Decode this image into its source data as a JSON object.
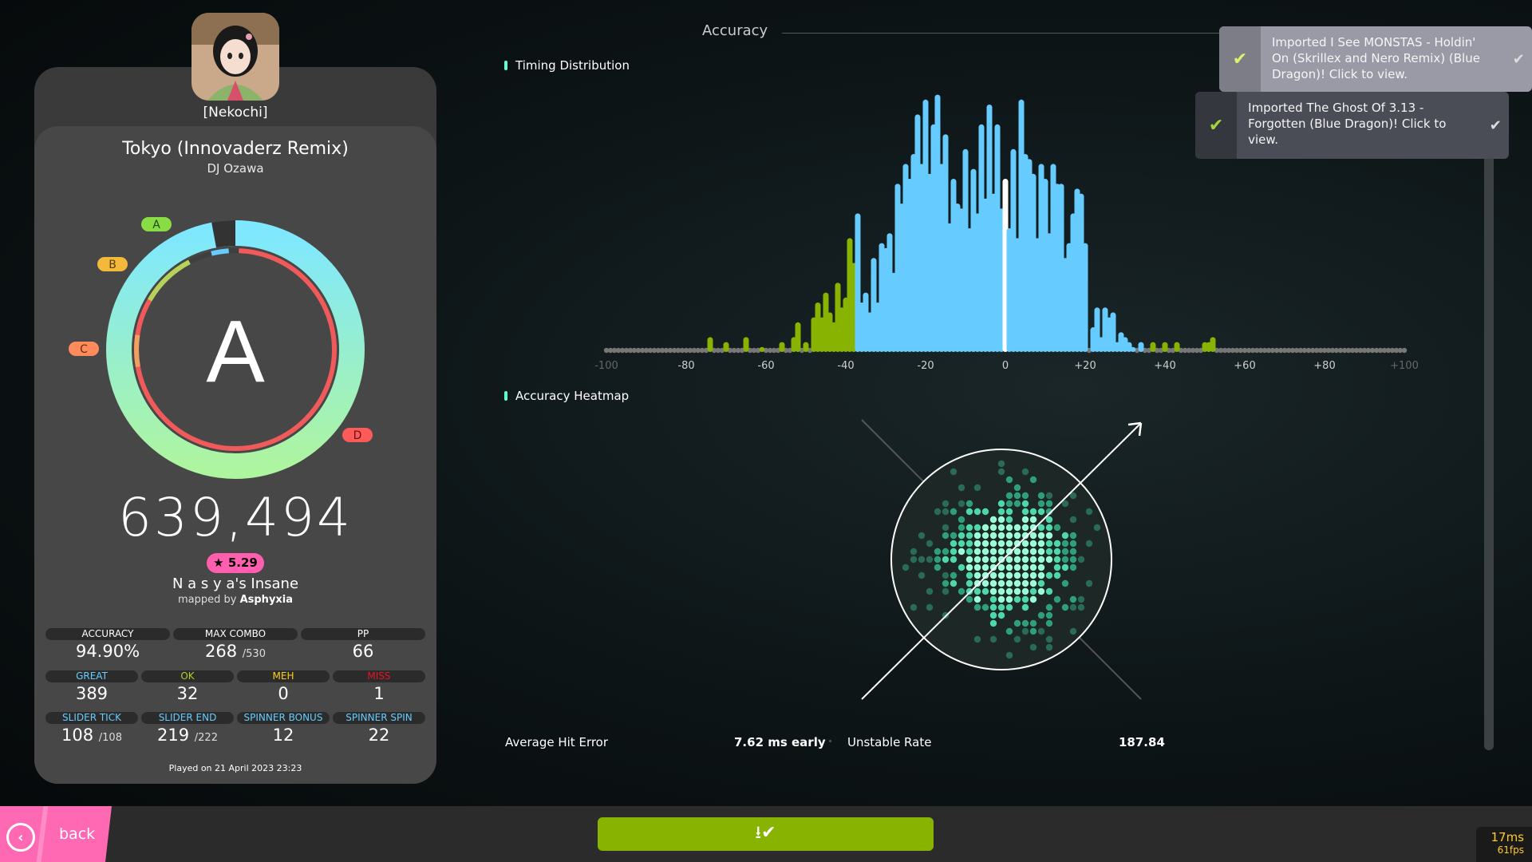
{
  "user": {
    "name": "[Nekochi]"
  },
  "beatmap": {
    "title": "Tokyo (Innovaderz Remix)",
    "artist": "DJ Ozawa",
    "star_rating": "★ 5.29",
    "difficulty": "N a s y a's Insane",
    "mapped_by_prefix": "mapped by",
    "mapper": "Asphyxia"
  },
  "rank": {
    "grade": "A",
    "marker_labels": [
      "A",
      "B",
      "C",
      "D"
    ]
  },
  "score": "639,494",
  "stats_top": [
    {
      "label": "ACCURACY",
      "value": "94.90%",
      "suffix": ""
    },
    {
      "label": "MAX COMBO",
      "value": "268",
      "suffix": "/530"
    },
    {
      "label": "PP",
      "value": "66",
      "suffix": ""
    }
  ],
  "stats_hits": [
    {
      "label": "GREAT",
      "value": "389",
      "color": "#66ccff"
    },
    {
      "label": "OK",
      "value": "32",
      "color": "#88b300"
    },
    {
      "label": "MEH",
      "value": "0",
      "color": "#ffcc22"
    },
    {
      "label": "MISS",
      "value": "1",
      "color": "#ed1121"
    }
  ],
  "stats_extra": [
    {
      "label": "SLIDER TICK",
      "value": "108",
      "suffix": "/108"
    },
    {
      "label": "SLIDER END",
      "value": "219",
      "suffix": "/222"
    },
    {
      "label": "SPINNER BONUS",
      "value": "12",
      "suffix": ""
    },
    {
      "label": "SPINNER SPIN",
      "value": "22",
      "suffix": ""
    }
  ],
  "played_on": "Played on 21 April 2023 23:23",
  "accuracy_section": {
    "header": "Accuracy",
    "timing_label": "Timing Distribution",
    "heatmap_label": "Accuracy Heatmap",
    "average_hit_error_label": "Average Hit Error",
    "average_hit_error_value": "7.62 ms early",
    "unstable_rate_label": "Unstable Rate",
    "unstable_rate_value": "187.84"
  },
  "chart_data": {
    "type": "bar",
    "x_tick_labels": [
      "-100",
      "-80",
      "-60",
      "-40",
      "-20",
      "0",
      "+20",
      "+40",
      "+60",
      "+80",
      "+100"
    ],
    "xlim": [
      -100,
      100
    ],
    "x": [
      -74,
      -70,
      -65,
      -61,
      -56,
      -53,
      -52,
      -50,
      -48,
      -47,
      -46,
      -45,
      -44,
      -43,
      -42,
      -41,
      -40,
      -39,
      -38,
      -37,
      -36,
      -35,
      -34,
      -33,
      -32,
      -31,
      -30,
      -29,
      -28,
      -27,
      -26,
      -25,
      -24,
      -23,
      -22,
      -21,
      -20,
      -19,
      -18,
      -17,
      -16,
      -15,
      -14,
      -13,
      -12,
      -11,
      -10,
      -9,
      -8,
      -7,
      -6,
      -5,
      -4,
      -3,
      -2,
      -1,
      0,
      1,
      2,
      3,
      4,
      5,
      6,
      7,
      8,
      9,
      10,
      11,
      12,
      13,
      14,
      15,
      16,
      17,
      18,
      19,
      20,
      22,
      23,
      24,
      25,
      26,
      27,
      28,
      29,
      30,
      31,
      32,
      34,
      37,
      40,
      43,
      50,
      51,
      52
    ],
    "values": [
      3,
      2,
      3,
      1,
      2,
      3,
      6,
      2,
      7,
      10,
      7,
      12,
      8,
      6,
      14,
      9,
      11,
      23,
      18,
      28,
      10,
      12,
      8,
      19,
      10,
      22,
      21,
      24,
      16,
      34,
      30,
      38,
      35,
      40,
      48,
      38,
      51,
      36,
      46,
      52,
      38,
      44,
      26,
      35,
      30,
      29,
      41,
      25,
      37,
      28,
      46,
      31,
      50,
      32,
      46,
      29,
      35,
      25,
      41,
      23,
      51,
      40,
      39,
      36,
      23,
      38,
      35,
      24,
      38,
      34,
      34,
      19,
      22,
      28,
      33,
      32,
      22,
      5,
      9,
      3,
      9,
      7,
      8,
      2,
      4,
      3,
      2,
      1,
      2,
      2,
      2,
      2,
      2,
      2,
      3
    ],
    "series_colors": {
      "great": "#66ccff",
      "ok": "#88b300",
      "center": "#ffffff"
    }
  },
  "notifications": [
    {
      "text": "Imported I See MONSTAS - Holdin' On (Skrillex and Nero Remix) (Blue Dragon)! Click to view."
    },
    {
      "text": "Imported The Ghost Of 3.13 - Forgotten (Blue Dragon)! Click to view."
    }
  ],
  "footer": {
    "back_label": "back",
    "back_icon": "chevron-left-icon",
    "download_icon": "download-check-icon"
  },
  "perf": {
    "frame_time": "17ms",
    "fps": "61fps"
  },
  "colors": {
    "accent_pink": "#ff69b4",
    "accent_green": "#88b300",
    "great_blue": "#66ccff"
  }
}
